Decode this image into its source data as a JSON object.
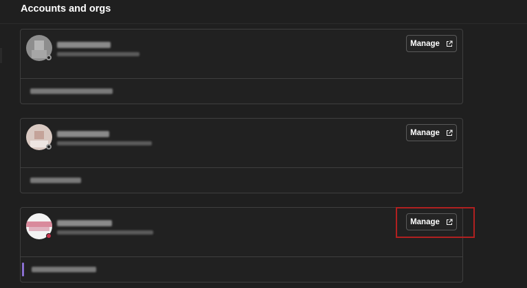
{
  "header": {
    "title": "Accounts and orgs"
  },
  "accounts": [
    {
      "manage_label": "Manage",
      "presence": "offline",
      "avatar_icon": "user-avatar-icon"
    },
    {
      "manage_label": "Manage",
      "presence": "offline",
      "avatar_icon": "user-avatar-icon"
    },
    {
      "manage_label": "Manage",
      "presence": "busy",
      "avatar_icon": "user-avatar-icon"
    }
  ],
  "icons": {
    "manage_suffix": "external-link-icon"
  },
  "colors": {
    "background": "#1f1f1f",
    "card_border": "#3f3f3f",
    "highlight": "#b22020",
    "accent": "#8a6fd1"
  }
}
